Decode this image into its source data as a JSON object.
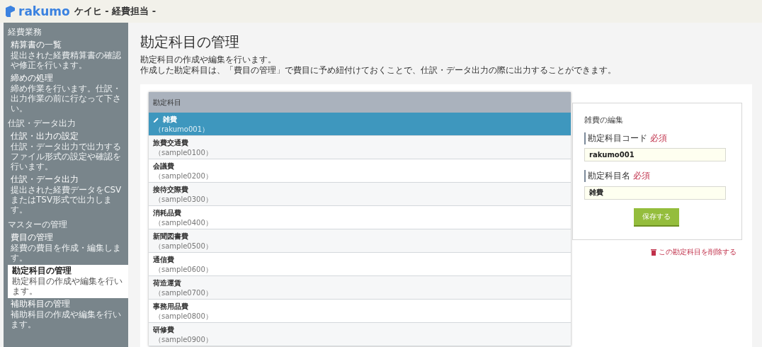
{
  "header": {
    "logo": "rakumo",
    "title": "ケイヒ - 経費担当 -"
  },
  "sidebar": {
    "sections": [
      {
        "heading": "経費業務",
        "items": [
          {
            "title": "精算書の一覧",
            "description": "提出された経費精算書の確認や修正を行います。",
            "selected": false
          },
          {
            "title": "締めの処理",
            "description": "締め作業を行います。仕訳・出力作業の前に行なって下さい。",
            "selected": false
          }
        ]
      },
      {
        "heading": "仕訳・データ出力",
        "items": [
          {
            "title": "仕訳・出力の設定",
            "description": "仕訳・データ出力で出力するファイル形式の設定や確認を行います。",
            "selected": false
          },
          {
            "title": "仕訳・データ出力",
            "description": "提出された経費データをCSVまたはTSV形式で出力します。",
            "selected": false
          }
        ]
      },
      {
        "heading": "マスターの管理",
        "items": [
          {
            "title": "費目の管理",
            "description": "経費の費目を作成・編集します。",
            "selected": false
          },
          {
            "title": "勘定科目の管理",
            "description": "勘定科目の作成や編集を行います。",
            "selected": true
          },
          {
            "title": "補助科目の管理",
            "description": "補助科目の作成や編集を行います。",
            "selected": false
          }
        ]
      }
    ]
  },
  "page": {
    "title": "勘定科目の管理",
    "descriptions": [
      "勘定科目の作成や編集を行います。",
      "作成した勘定科目は、「費目の管理」で費目に予め紐付けておくことで、仕訳・データ出力の際に出力することができます。"
    ]
  },
  "list": {
    "header": "勘定科目",
    "rows": [
      {
        "name": "雑費",
        "code": "（rakumo001）",
        "selected": true
      },
      {
        "name": "旅費交通費",
        "code": "（sample0100）",
        "selected": false
      },
      {
        "name": "会議費",
        "code": "（sample0200）",
        "selected": false
      },
      {
        "name": "接待交際費",
        "code": "（sample0300）",
        "selected": false
      },
      {
        "name": "消耗品費",
        "code": "（sample0400）",
        "selected": false
      },
      {
        "name": "新聞図書費",
        "code": "（sample0500）",
        "selected": false
      },
      {
        "name": "通信費",
        "code": "（sample0600）",
        "selected": false
      },
      {
        "name": "荷造運賃",
        "code": "（sample0700）",
        "selected": false
      },
      {
        "name": "事務用品費",
        "code": "（sample0800）",
        "selected": false
      },
      {
        "name": "研修費",
        "code": "（sample0900）",
        "selected": false
      }
    ]
  },
  "editor": {
    "title": "雑費の編集",
    "fields": [
      {
        "label": "勘定科目コード",
        "required": "必須",
        "value": "rakumo001"
      },
      {
        "label": "勘定科目名",
        "required": "必須",
        "value": "雑費"
      }
    ],
    "save_button": "保存する",
    "delete_link": "この勘定科目を削除する"
  }
}
